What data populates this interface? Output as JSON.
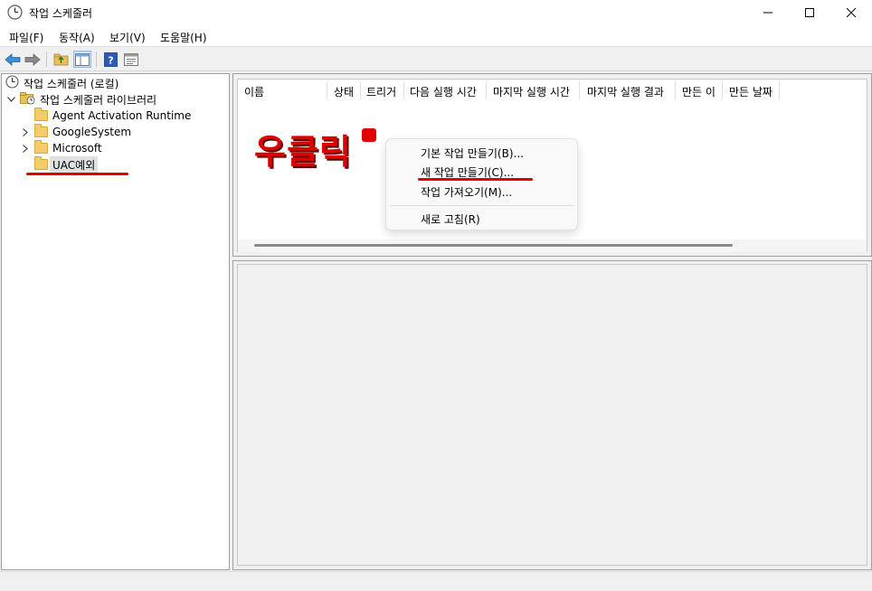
{
  "window": {
    "title": "작업 스케줄러",
    "icon": "clock-icon"
  },
  "menubar": {
    "items": [
      {
        "label": "파일(F)"
      },
      {
        "label": "동작(A)"
      },
      {
        "label": "보기(V)"
      },
      {
        "label": "도움말(H)"
      }
    ]
  },
  "toolbar": {
    "icons": [
      "back-arrow-icon",
      "forward-arrow-icon",
      "folder-up-icon",
      "show-hide-tree-icon",
      "help-icon",
      "properties-icon"
    ]
  },
  "tree": {
    "root": "작업 스케줄러 (로컬)",
    "library": "작업 스케줄러 라이브러리",
    "items": [
      {
        "label": "Agent Activation Runtime"
      },
      {
        "label": "GoogleSystem"
      },
      {
        "label": "Microsoft"
      },
      {
        "label": "UAC예외"
      }
    ]
  },
  "list": {
    "columns": [
      {
        "label": "이름"
      },
      {
        "label": "상태"
      },
      {
        "label": "트리거"
      },
      {
        "label": "다음 실행 시간"
      },
      {
        "label": "마지막 실행 시간"
      },
      {
        "label": "마지막 실행 결과"
      },
      {
        "label": "만든 이"
      },
      {
        "label": "만든 날짜"
      }
    ]
  },
  "context_menu": {
    "items": [
      {
        "label": "기본 작업 만들기(B)..."
      },
      {
        "label": "새 작업 만들기(C)..."
      },
      {
        "label": "작업 가져오기(M)..."
      },
      {
        "label": "새로 고침(R)"
      }
    ]
  },
  "annotation": {
    "text": "우클릭",
    "color": "#e00000"
  }
}
